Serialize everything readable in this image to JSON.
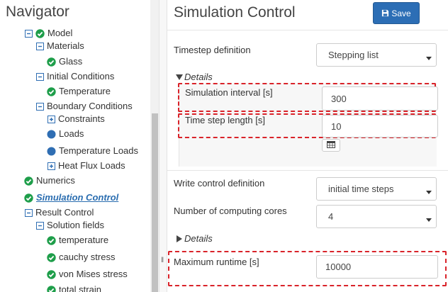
{
  "navigator": {
    "title": "Navigator",
    "items": [
      {
        "label": "Model",
        "level": 0,
        "expander": "minus",
        "status": "check"
      },
      {
        "label": "Materials",
        "level": 1,
        "expander": "minus",
        "status": "none"
      },
      {
        "label": "Glass",
        "level": 2,
        "expander": "none",
        "status": "check"
      },
      {
        "label": "Initial Conditions",
        "level": 1,
        "expander": "minus",
        "status": "none"
      },
      {
        "label": "Temperature",
        "level": 2,
        "expander": "none",
        "status": "check"
      },
      {
        "label": "Boundary Conditions",
        "level": 1,
        "expander": "minus",
        "status": "none"
      },
      {
        "label": "Constraints",
        "level": 2,
        "expander": "plus",
        "status": "none"
      },
      {
        "label": "Loads",
        "level": 2,
        "expander": "none",
        "status": "dot"
      },
      {
        "label": "Temperature Loads",
        "level": 2,
        "expander": "none",
        "status": "dot"
      },
      {
        "label": "Heat Flux Loads",
        "level": 2,
        "expander": "plus",
        "status": "none"
      },
      {
        "label": "Numerics",
        "level": 0,
        "expander": "none",
        "status": "check"
      },
      {
        "label": "Simulation Control",
        "level": 0,
        "expander": "none",
        "status": "check",
        "active": true
      },
      {
        "label": "Result Control",
        "level": 0,
        "expander": "minus",
        "status": "none"
      },
      {
        "label": "Solution fields",
        "level": 1,
        "expander": "minus",
        "status": "none"
      },
      {
        "label": "temperature",
        "level": 2,
        "expander": "none",
        "status": "check"
      },
      {
        "label": "cauchy stress",
        "level": 2,
        "expander": "none",
        "status": "check"
      },
      {
        "label": "von Mises stress",
        "level": 2,
        "expander": "none",
        "status": "check"
      },
      {
        "label": "total strain",
        "level": 2,
        "expander": "none",
        "status": "check"
      }
    ]
  },
  "main": {
    "title": "Simulation Control",
    "save_label": "Save",
    "timestep_definition": {
      "label": "Timestep definition",
      "value": "Stepping list"
    },
    "details_1": {
      "label": "Details",
      "state": "expanded"
    },
    "simulation_interval": {
      "label": "Simulation interval [s]",
      "value": "300"
    },
    "time_step_length": {
      "label": "Time step length [s]",
      "value": "10"
    },
    "write_control": {
      "label": "Write control definition",
      "value": "initial time steps"
    },
    "computing_cores": {
      "label": "Number of computing cores",
      "value": "4"
    },
    "details_2": {
      "label": "Details",
      "state": "collapsed"
    },
    "maximum_runtime": {
      "label": "Maximum runtime [s]",
      "value": "10000"
    }
  },
  "colors": {
    "check_green": "#1e9e4a",
    "dot_blue": "#2f6eb3",
    "primary_blue": "#2c6eb5",
    "highlight_red": "#d9232a",
    "active_link": "#2a6db0"
  },
  "icons": {
    "expander_minus": "minus-square-icon",
    "expander_plus": "plus-square-icon",
    "status_check": "check-circle-icon",
    "status_dot": "dot-circle-icon",
    "save": "floppy-disk-icon",
    "select_caret": "caret-down-icon",
    "details_expanded": "triangle-down-icon",
    "details_collapsed": "triangle-right-icon",
    "calendar": "calendar-grid-icon",
    "splitter": "splitter-grip-icon"
  }
}
